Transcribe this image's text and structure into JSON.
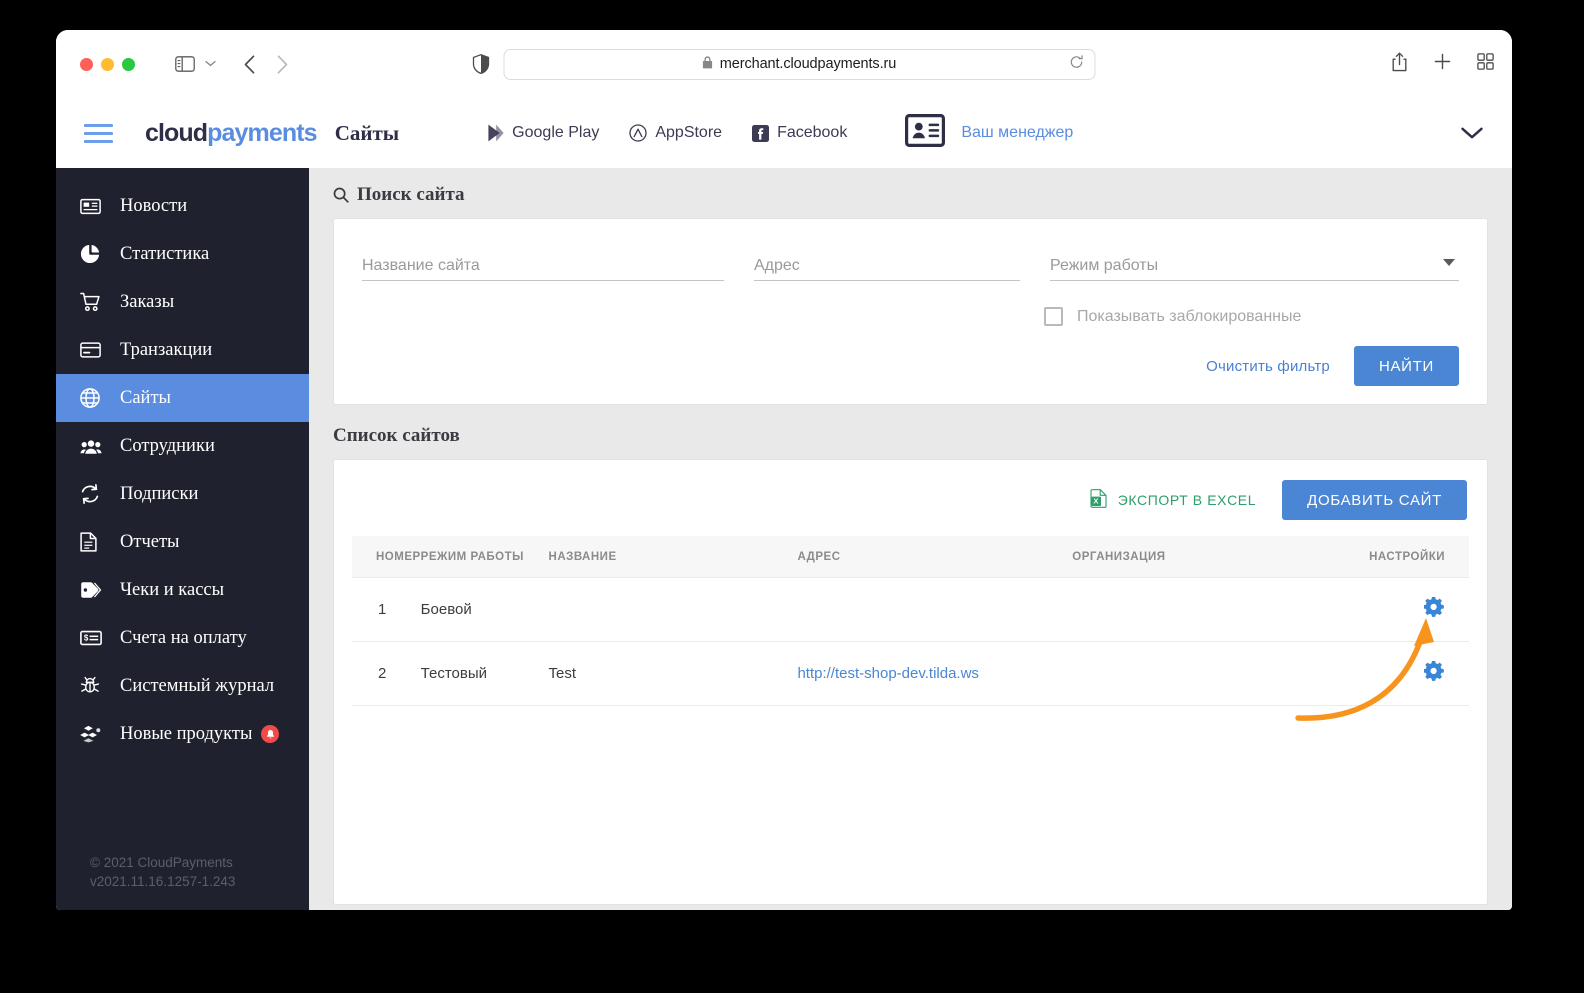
{
  "browser": {
    "url": "merchant.cloudpayments.ru",
    "lock_icon": "lock-icon",
    "reload_icon": "reload-icon",
    "shield_icon": "shield-icon",
    "sidebar_toggle_icon": "sidebar-toggle-icon",
    "back_icon": "chevron-left-icon",
    "forward_icon": "chevron-right-icon",
    "share_icon": "share-icon",
    "new_tab_icon": "plus-icon",
    "tab_overview_icon": "tab-overview-icon"
  },
  "header": {
    "menu_icon": "hamburger-icon",
    "logo_first": "cloud",
    "logo_second": "payments",
    "page_title": "Сайты",
    "links": [
      {
        "label": "Google Play",
        "icon": "google-play-icon"
      },
      {
        "label": "AppStore",
        "icon": "appstore-icon"
      },
      {
        "label": "Facebook",
        "icon": "facebook-icon"
      }
    ],
    "manager_label": "Ваш менеджер",
    "manager_icon": "contact-card-icon",
    "chevron_icon": "chevron-down-icon"
  },
  "sidebar": {
    "items": [
      {
        "label": "Новости",
        "icon": "news-icon",
        "active": false
      },
      {
        "label": "Статистика",
        "icon": "pie-chart-icon",
        "active": false
      },
      {
        "label": "Заказы",
        "icon": "cart-icon",
        "active": false
      },
      {
        "label": "Транзакции",
        "icon": "credit-card-icon",
        "active": false
      },
      {
        "label": "Сайты",
        "icon": "globe-icon",
        "active": true
      },
      {
        "label": "Сотрудники",
        "icon": "people-icon",
        "active": false
      },
      {
        "label": "Подписки",
        "icon": "refresh-icon",
        "active": false
      },
      {
        "label": "Отчеты",
        "icon": "document-icon",
        "active": false
      },
      {
        "label": "Чеки и кассы",
        "icon": "tag-icon",
        "active": false
      },
      {
        "label": "Счета на оплату",
        "icon": "invoice-icon",
        "active": false
      },
      {
        "label": "Системный журнал",
        "icon": "bug-icon",
        "active": false
      },
      {
        "label": "Новые продукты",
        "icon": "cubes-icon",
        "active": false,
        "badge": "bell-badge"
      }
    ],
    "copyright": "© 2021 CloudPayments",
    "version": "v2021.11.16.1257-1.243"
  },
  "search": {
    "heading": "Поиск сайта",
    "heading_icon": "search-icon",
    "name_placeholder": "Название сайта",
    "name_value": "",
    "address_placeholder": "Адрес",
    "address_value": "",
    "mode_placeholder": "Режим работы",
    "mode_value": "",
    "mode_caret_icon": "caret-down-icon",
    "checkbox_label": "Показывать заблокированные",
    "checkbox_checked": false,
    "clear_label": "Очистить фильтр",
    "submit_label": "НАЙТИ"
  },
  "list": {
    "heading": "Список сайтов",
    "export_label": "ЭКСПОРТ В EXCEL",
    "export_icon": "excel-icon",
    "add_label": "ДОБАВИТЬ САЙТ",
    "columns": [
      "НОМЕР",
      "РЕЖИМ РАБОТЫ",
      "НАЗВАНИЕ",
      "АДРЕС",
      "ОРГАНИЗАЦИЯ",
      "НАСТРОЙКИ"
    ],
    "rows": [
      {
        "number": "1",
        "mode": "Боевой",
        "name": "",
        "address": "",
        "organization": "",
        "settings_icon": "gear-icon"
      },
      {
        "number": "2",
        "mode": "Тестовый",
        "name": "Test",
        "address": "http://test-shop-dev.tilda.ws",
        "organization": "",
        "settings_icon": "gear-icon"
      }
    ]
  },
  "annotation": {
    "arrow_icon": "curved-arrow-icon",
    "arrow_color": "#f7941e"
  },
  "colors": {
    "accent_blue": "#4a86d4",
    "sidebar_bg": "#20212e",
    "page_bg": "#e9e9e9",
    "excel_green": "#2e9e6b",
    "badge_red": "#f04a4a",
    "logo_navy": "#2f2e47"
  }
}
